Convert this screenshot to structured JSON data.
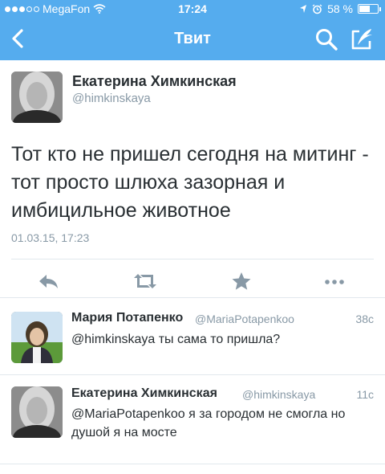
{
  "status_bar": {
    "carrier": "MegaFon",
    "time": "17:24",
    "battery_text": "58 %",
    "battery_level": 0.58,
    "signal_bars": 3,
    "signal_total": 5
  },
  "nav": {
    "title": "Твит",
    "icons": [
      "back-chevron-icon",
      "search-icon",
      "compose-icon"
    ]
  },
  "main_tweet": {
    "author_name": "Екатерина Химкинская",
    "handle": "@himkinskaya",
    "text": "Тот кто не пришел сегодня на митинг - тот просто шлюха зазорная и имбицильное животное",
    "date": "01.03.15, 17:23",
    "actions": [
      "reply-icon",
      "retweet-icon",
      "favorite-icon",
      "more-icon"
    ]
  },
  "replies": [
    {
      "author_name": "Мария Потапенко",
      "handle": "@MariaPotapenkoo",
      "time": "38с",
      "text": "@himkinskaya ты сама то пришла?"
    },
    {
      "author_name": "Екатерина Химкинская",
      "handle": "@himkinskaya",
      "time": "11с",
      "text": "@MariaPotapenkoo я за городом не смогла но душой я на мосте"
    }
  ],
  "colors": {
    "header_bg": "#55acee",
    "text": "#292f33",
    "secondary_text": "#8899a6",
    "icon_gray": "#8899a6",
    "divider": "#e1e8ed"
  }
}
